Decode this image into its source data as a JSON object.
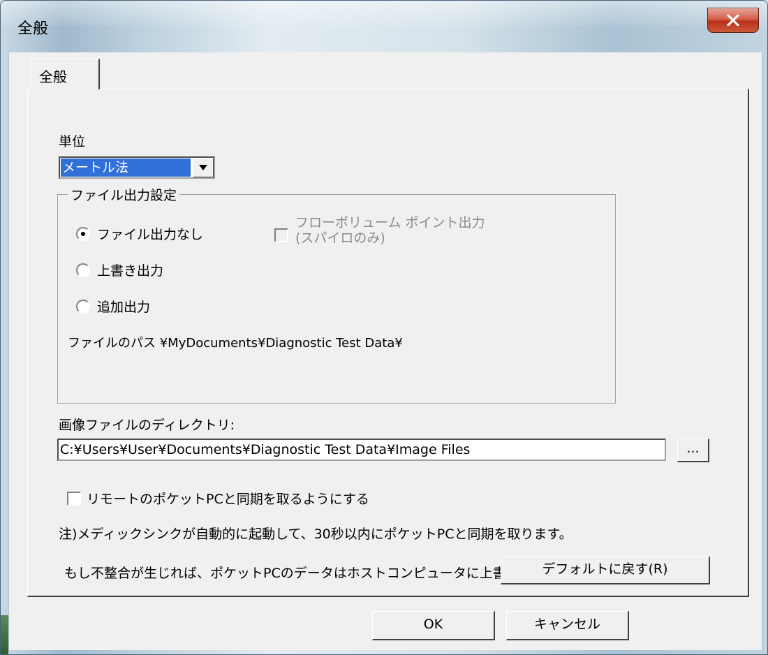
{
  "window": {
    "title": "全般"
  },
  "tabs": [
    {
      "label": "全般"
    }
  ],
  "units": {
    "label": "単位",
    "selected": "メートル法"
  },
  "file_output": {
    "legend": "ファイル出力設定",
    "options": [
      {
        "label": "ファイル出力なし",
        "checked": true
      },
      {
        "label": "上書き出力",
        "checked": false
      },
      {
        "label": "追加出力",
        "checked": false
      }
    ],
    "flow_volume": {
      "line1": "フローボリューム ポイント出力",
      "line2": "(スパイロのみ)"
    },
    "path_text": "ファイルのパス ¥MyDocuments¥Diagnostic Test Data¥"
  },
  "image_dir": {
    "label": "画像ファイルのディレクトリ:",
    "value": "C:¥Users¥User¥Documents¥Diagnostic Test Data¥Image Files",
    "browse_label": "..."
  },
  "sync": {
    "label": "リモートのポケットPCと同期を取るようにする",
    "note1": "注)メディックシンクが自動的に起動して、30秒以内にポケットPCと同期を取ります。",
    "note2": "もし不整合が生じれば、ポケットPCのデータはホストコンピュータに上書きをします。"
  },
  "buttons": {
    "default_label": "デフォルトに戻す(R)",
    "ok_label": "OK",
    "cancel_label": "キャンセル"
  }
}
